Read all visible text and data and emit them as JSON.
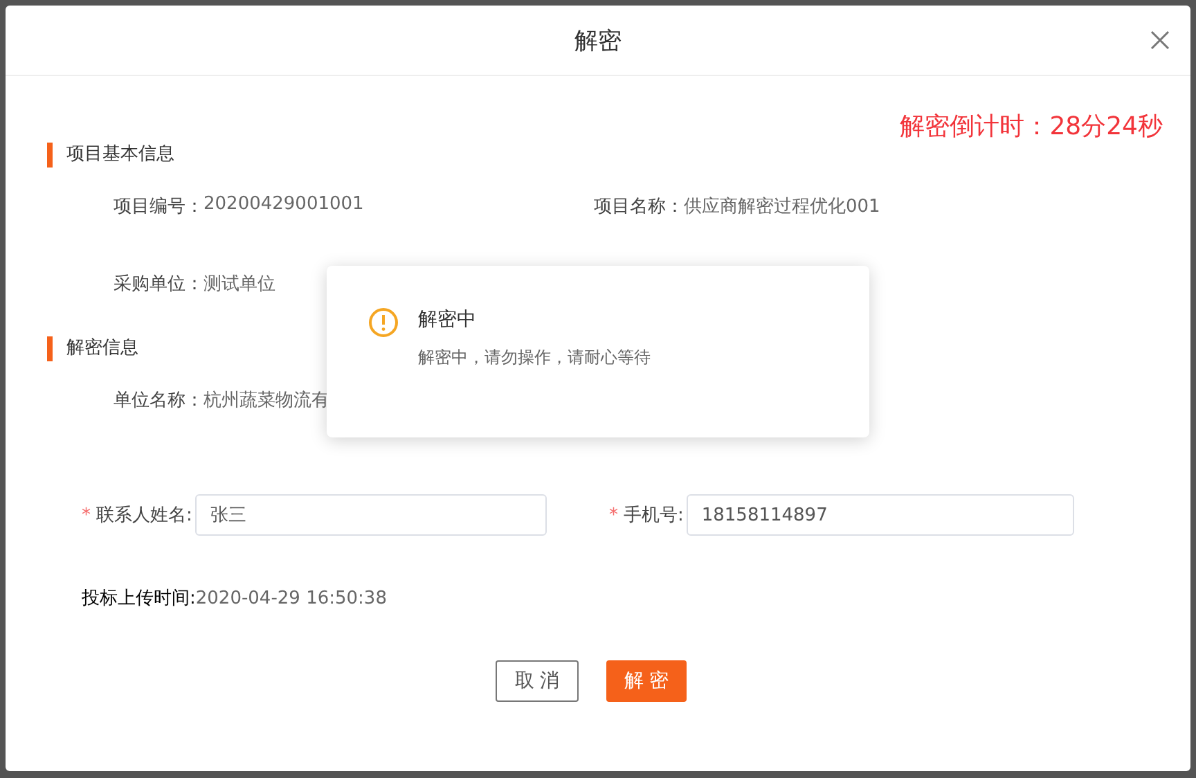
{
  "dialog": {
    "title": "解密",
    "countdown": "解密倒计时：28分24秒"
  },
  "sections": [
    {
      "title": "项目基本信息",
      "rows": [
        [
          {
            "label": "项目编号：",
            "value": "20200429001001"
          },
          {
            "label": "项目名称：",
            "value": "供应商解密过程优化001"
          }
        ],
        [
          {
            "label": "采购单位：",
            "value": "测试单位"
          }
        ]
      ]
    },
    {
      "title": "解密信息",
      "rows": [
        [
          {
            "label": "单位名称：",
            "value": "杭州蔬菜物流有"
          }
        ]
      ]
    }
  ],
  "contact_fields": [
    {
      "required_mark": "*",
      "label": "联系人姓名:",
      "required": true,
      "value": "张三"
    },
    {
      "required_mark": "*",
      "label": "手机号:",
      "required": true,
      "value": "18158114897"
    }
  ],
  "upload_time": {
    "label": "投标上传时间:",
    "value": "2020-04-29 16:50:38"
  },
  "buttons": [
    {
      "label": "取 消",
      "kind": "secondary"
    },
    {
      "label": "解 密",
      "kind": "primary"
    }
  ],
  "notification": {
    "title": "解密中",
    "message": "解密中，请勿操作，请耐心等待"
  }
}
